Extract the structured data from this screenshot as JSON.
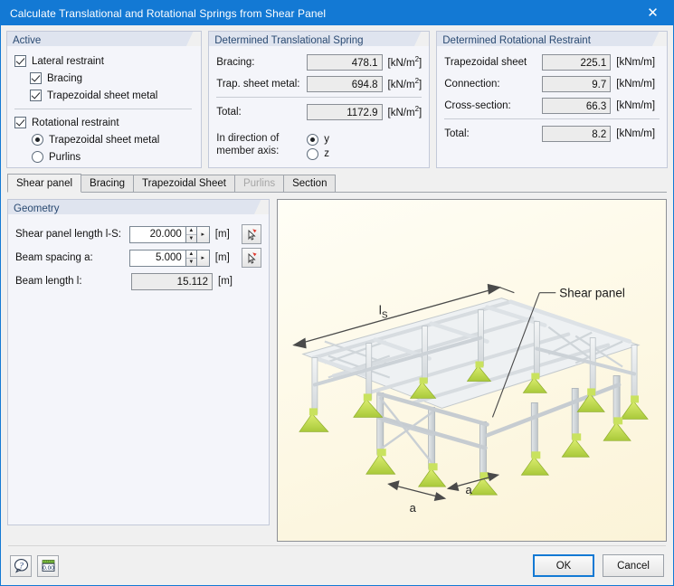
{
  "window": {
    "title": "Calculate Translational and Rotational Springs from Shear Panel",
    "close_label": "✕",
    "accent_color": "#1379d4"
  },
  "active_group": {
    "title": "Active",
    "lateral_restraint": {
      "label": "Lateral restraint",
      "checked": true
    },
    "bracing": {
      "label": "Bracing",
      "checked": true
    },
    "trapezoidal_sheet_metal": {
      "label": "Trapezoidal sheet metal",
      "checked": true
    },
    "rotational_restraint": {
      "label": "Rotational restraint",
      "checked": true
    },
    "rot_options": [
      {
        "label": "Trapezoidal sheet metal",
        "selected": true
      },
      {
        "label": "Purlins",
        "selected": false
      }
    ]
  },
  "translational_group": {
    "title": "Determined Translational Spring",
    "rows": [
      {
        "label": "Bracing:",
        "value": "478.1",
        "unit": "kN/m",
        "exp": "2"
      },
      {
        "label": "Trap. sheet metal:",
        "value": "694.8",
        "unit": "kN/m",
        "exp": "2"
      }
    ],
    "total": {
      "label": "Total:",
      "value": "1172.9",
      "unit": "kN/m",
      "exp": "2"
    },
    "axis": {
      "label_line1": "In direction of",
      "label_line2": "member axis:",
      "options": [
        {
          "label": "y",
          "selected": true
        },
        {
          "label": "z",
          "selected": false
        }
      ]
    }
  },
  "rotational_group": {
    "title": "Determined Rotational Restraint",
    "rows": [
      {
        "label": "Trapezoidal sheet",
        "value": "225.1",
        "unit": "kNm/m"
      },
      {
        "label": "Connection:",
        "value": "9.7",
        "unit": "kNm/m"
      },
      {
        "label": "Cross-section:",
        "value": "66.3",
        "unit": "kNm/m"
      }
    ],
    "total": {
      "label": "Total:",
      "value": "8.2",
      "unit": "kNm/m"
    }
  },
  "tabs": [
    {
      "label": "Shear panel",
      "active": true,
      "disabled": false
    },
    {
      "label": "Bracing",
      "active": false,
      "disabled": false
    },
    {
      "label": "Trapezoidal Sheet",
      "active": false,
      "disabled": false
    },
    {
      "label": "Purlins",
      "active": false,
      "disabled": true
    },
    {
      "label": "Section",
      "active": false,
      "disabled": false
    }
  ],
  "geometry": {
    "title": "Geometry",
    "shear_panel_length": {
      "label": "Shear panel length l-S:",
      "value": "20.000",
      "unit": "[m]"
    },
    "beam_spacing": {
      "label": "Beam spacing a:",
      "value": "5.000",
      "unit": "[m]"
    },
    "beam_length": {
      "label": "Beam length l:",
      "value": "15.112",
      "unit": "[m]"
    },
    "pick_icon": "pick-from-model-icon",
    "spinner_up": "▲",
    "spinner_down": "▼",
    "spinner_more": "▸"
  },
  "illustration": {
    "name": "shear-panel-3d-diagram",
    "label_shear_panel": "Shear panel",
    "label_ls": "l",
    "label_ls_sub": "S",
    "label_a_1": "a",
    "label_a_2": "a"
  },
  "bottom": {
    "help_icon": "help-bubble-icon",
    "units_icon": "units-decimal-places-icon",
    "units_icon_text": "0.00",
    "ok_label": "OK",
    "cancel_label": "Cancel"
  }
}
